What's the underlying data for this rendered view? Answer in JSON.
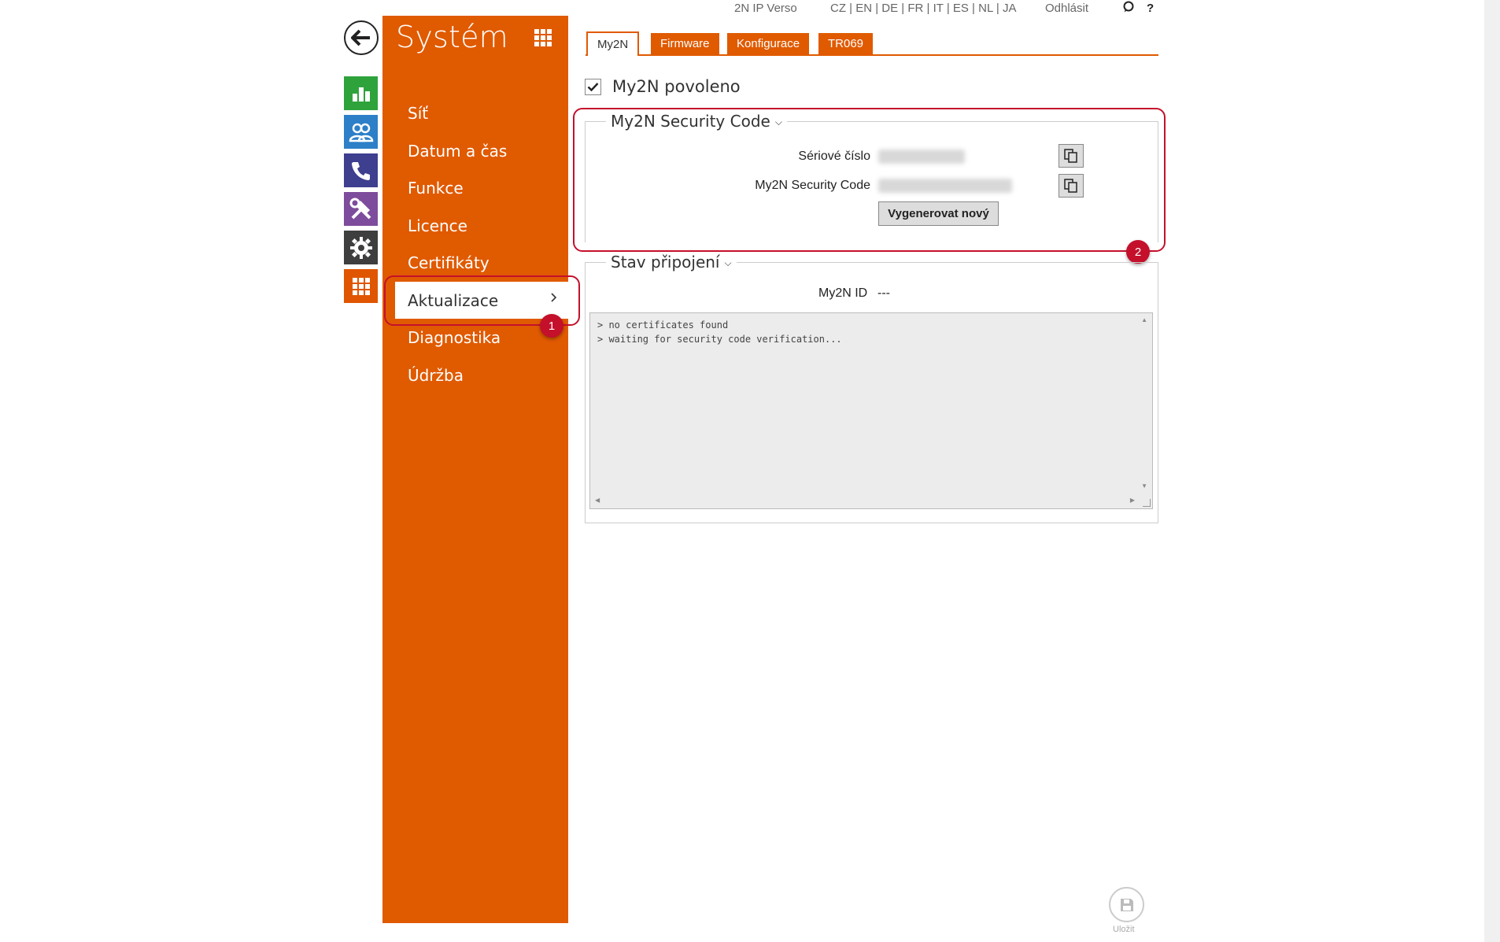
{
  "header": {
    "device_name": "2N IP Verso",
    "languages": "CZ | EN | DE | FR | IT | ES | NL | JA",
    "logout": "Odhlásit",
    "help": "?"
  },
  "rail": {
    "icons": [
      "back-arrow-icon",
      "status-chart-icon",
      "directory-users-icon",
      "phone-services-icon",
      "hardware-tools-icon",
      "settings-gear-icon",
      "system-grid-icon"
    ]
  },
  "sidebar": {
    "title": "Systém",
    "items": [
      {
        "label": "Síť"
      },
      {
        "label": "Datum a čas"
      },
      {
        "label": "Funkce"
      },
      {
        "label": "Licence"
      },
      {
        "label": "Certifikáty"
      },
      {
        "label": "Aktualizace"
      },
      {
        "label": "Diagnostika"
      },
      {
        "label": "Údržba"
      }
    ],
    "active_index": 5
  },
  "tabs": [
    {
      "label": "My2N",
      "active": true
    },
    {
      "label": "Firmware",
      "active": false
    },
    {
      "label": "Konfigurace",
      "active": false
    },
    {
      "label": "TR069",
      "active": false
    }
  ],
  "main": {
    "enabled_label": "My2N povoleno",
    "enabled": true,
    "security_section": {
      "title": "My2N Security Code",
      "serial_label": "Sériové číslo",
      "code_label": "My2N Security Code",
      "generate_button": "Vygenerovat nový"
    },
    "status_section": {
      "title": "Stav připojení",
      "my2n_id_label": "My2N ID",
      "my2n_id_value": "---",
      "log_lines": [
        "> no certificates found",
        "> waiting for security code verification..."
      ]
    },
    "save_label": "Uložit"
  },
  "callouts": {
    "first": "1",
    "second": "2"
  },
  "colors": {
    "accent": "#e05a00",
    "callout": "#c4102b",
    "status": "#2ea33c",
    "directory": "#2d7fc8",
    "services": "#3e3f8f",
    "hardware": "#7e4c9c",
    "settings": "#3e3e3e"
  }
}
